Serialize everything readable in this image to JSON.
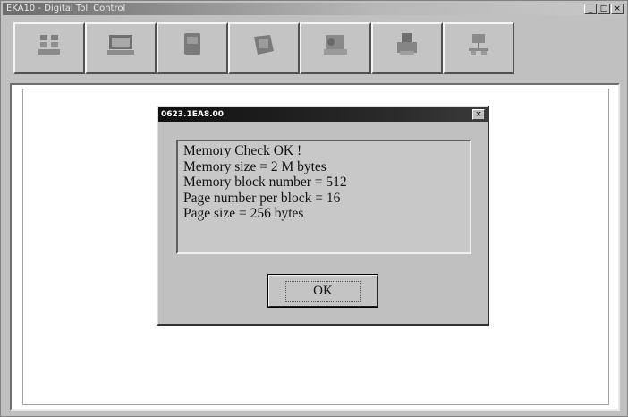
{
  "window": {
    "title": "EKA10 - Digital Toll Control",
    "buttons": {
      "minimize": "_",
      "maximize": "□",
      "close": "×"
    }
  },
  "toolbar": {
    "buttons": [
      {
        "icon": "reader-icon",
        "label": ""
      },
      {
        "icon": "monitor-icon",
        "label": ""
      },
      {
        "icon": "card-icon",
        "label": ""
      },
      {
        "icon": "folder-icon",
        "label": ""
      },
      {
        "icon": "device-icon",
        "label": ""
      },
      {
        "icon": "printer-icon",
        "label": ""
      },
      {
        "icon": "network-icon",
        "label": ""
      }
    ]
  },
  "dialog": {
    "title": "0623.1EA8.00",
    "close": "×",
    "lines": [
      "Memory Check OK !",
      "Memory size = 2 M bytes",
      "Memory block number = 512",
      "Page number per block = 16",
      "Page size = 256 bytes"
    ],
    "ok_label": "OK"
  }
}
